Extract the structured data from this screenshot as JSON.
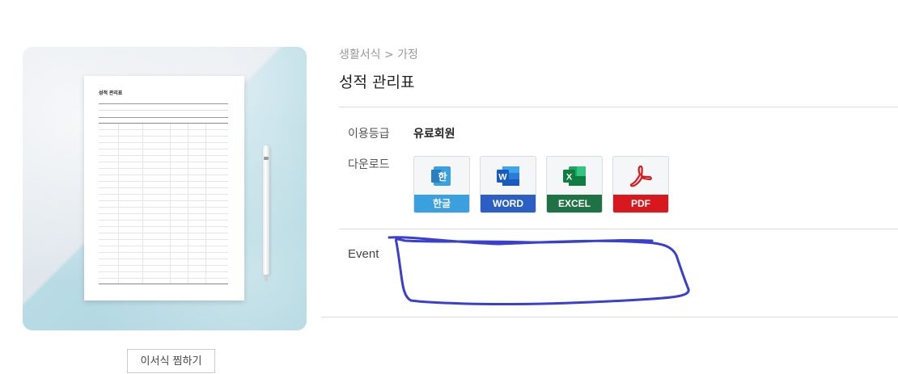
{
  "preview": {
    "paper_title": "성적 관리표",
    "bookmark_label": "이서식 찜하기"
  },
  "breadcrumb": "생활서식 > 가정",
  "title": "성적 관리표",
  "usage": {
    "label": "이용등급",
    "value": "유료회원"
  },
  "download": {
    "label": "다운로드",
    "formats": [
      {
        "label": "한글",
        "icon": "hangul-icon",
        "color": "#3aa0e0"
      },
      {
        "label": "WORD",
        "icon": "word-icon",
        "color": "#2b5fc3"
      },
      {
        "label": "EXCEL",
        "icon": "excel-icon",
        "color": "#1f7244"
      },
      {
        "label": "PDF",
        "icon": "pdf-icon",
        "color": "#d7191f"
      }
    ]
  },
  "event": {
    "label": "Event"
  },
  "colors": {
    "scribble": "#3a3fcf"
  }
}
